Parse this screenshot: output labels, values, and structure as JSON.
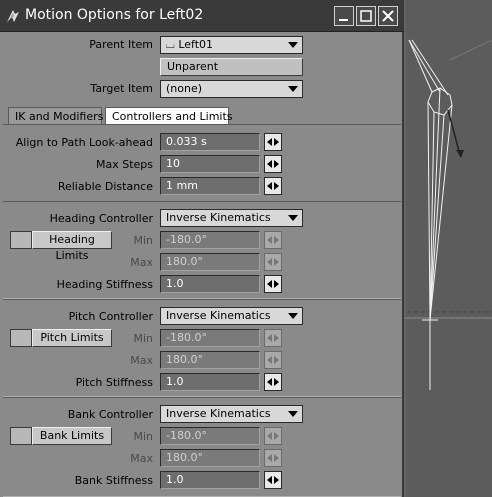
{
  "window": {
    "title": "Motion Options for Left02",
    "icon": "lightwave-motion-icon",
    "buttons": [
      "minimize",
      "maximize",
      "close"
    ]
  },
  "parent_item": {
    "label": "Parent Item",
    "value": "Left01",
    "icon": "bone-icon"
  },
  "unparent_label": "Unparent",
  "target_item": {
    "label": "Target Item",
    "value": "(none)"
  },
  "tabs": [
    {
      "label": "IK and Modifiers",
      "active": false
    },
    {
      "label": "Controllers and Limits",
      "active": true
    }
  ],
  "general": {
    "align_label": "Align to Path Look-ahead",
    "align_value": "0.033 s",
    "max_steps_label": "Max Steps",
    "max_steps_value": "10",
    "reliable_label": "Reliable Distance",
    "reliable_value": "1 mm"
  },
  "heading": {
    "controller_label": "Heading Controller",
    "controller_value": "Inverse Kinematics",
    "limits_label": "Heading Limits",
    "min_label": "Min",
    "min_value": "-180.0°",
    "max_label": "Max",
    "max_value": "180.0°",
    "stiffness_label": "Heading Stiffness",
    "stiffness_value": "1.0"
  },
  "pitch": {
    "controller_label": "Pitch Controller",
    "controller_value": "Inverse Kinematics",
    "limits_label": "Pitch Limits",
    "min_label": "Min",
    "min_value": "-180.0°",
    "max_label": "Max",
    "max_value": "180.0°",
    "stiffness_label": "Pitch Stiffness",
    "stiffness_value": "1.0"
  },
  "bank": {
    "controller_label": "Bank Controller",
    "controller_value": "Inverse Kinematics",
    "limits_label": "Bank Limits",
    "min_label": "Min",
    "min_value": "-180.0°",
    "max_label": "Max",
    "max_value": "180.0°",
    "stiffness_label": "Bank Stiffness",
    "stiffness_value": "1.0"
  },
  "colors": {
    "titlebar": "#3a3a3a",
    "panel": "#8a8a8a",
    "field": "#6e6e6e",
    "viewport": "#5a5a5a"
  }
}
